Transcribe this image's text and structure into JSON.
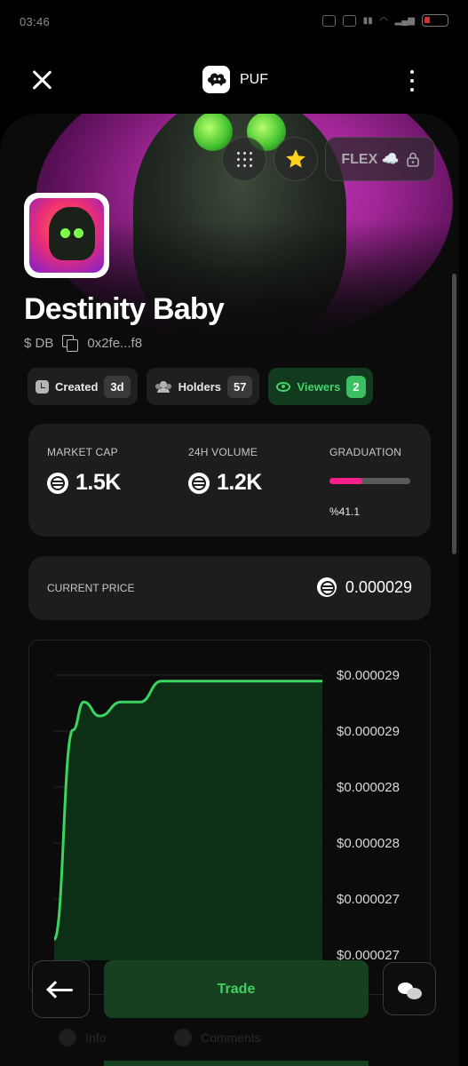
{
  "status_bar": {
    "time": "03:46"
  },
  "top_bar": {
    "app_name": "PUF"
  },
  "hero": {
    "flex_label": "FLEX ☁️"
  },
  "token": {
    "name": "Destinity Baby",
    "ticker": "$ DB",
    "address": "0x2fe...f8"
  },
  "pills": {
    "created_label": "Created",
    "created_value": "3d",
    "holders_label": "Holders",
    "holders_value": "57",
    "viewers_label": "Viewers",
    "viewers_value": "2"
  },
  "stats": {
    "market_cap_label": "MARKET CAP",
    "market_cap_value": "1.5K",
    "volume_label": "24H VOLUME",
    "volume_value": "1.2K",
    "graduation_label": "GRADUATION",
    "graduation_pct_text": "%41.1",
    "graduation_fraction": 0.411
  },
  "price": {
    "label": "CURRENT PRICE",
    "value": "0.000029"
  },
  "chart_data": {
    "type": "area",
    "y_tick_labels": [
      "$0.000029",
      "$0.000029",
      "$0.000028",
      "$0.000028",
      "$0.000027",
      "$0.000027"
    ],
    "series": [
      {
        "values": [
          2.72e-05,
          2.87e-05,
          2.89e-05,
          2.88e-05,
          2.89e-05,
          2.89e-05,
          2.905e-05,
          2.905e-05,
          2.905e-05,
          2.905e-05,
          2.905e-05,
          2.905e-05
        ]
      }
    ],
    "grid": true,
    "colors": {
      "line": "#3ad45e",
      "fill": "#0d3316"
    }
  },
  "actions": {
    "trade_label": "Trade"
  },
  "bottom_tabs": {
    "info_label": "Info",
    "comments_label": "Comments"
  },
  "colors": {
    "accent_green": "#3fd062",
    "accent_pink": "#ff1f8c",
    "card_bg": "#1d1d1d"
  }
}
